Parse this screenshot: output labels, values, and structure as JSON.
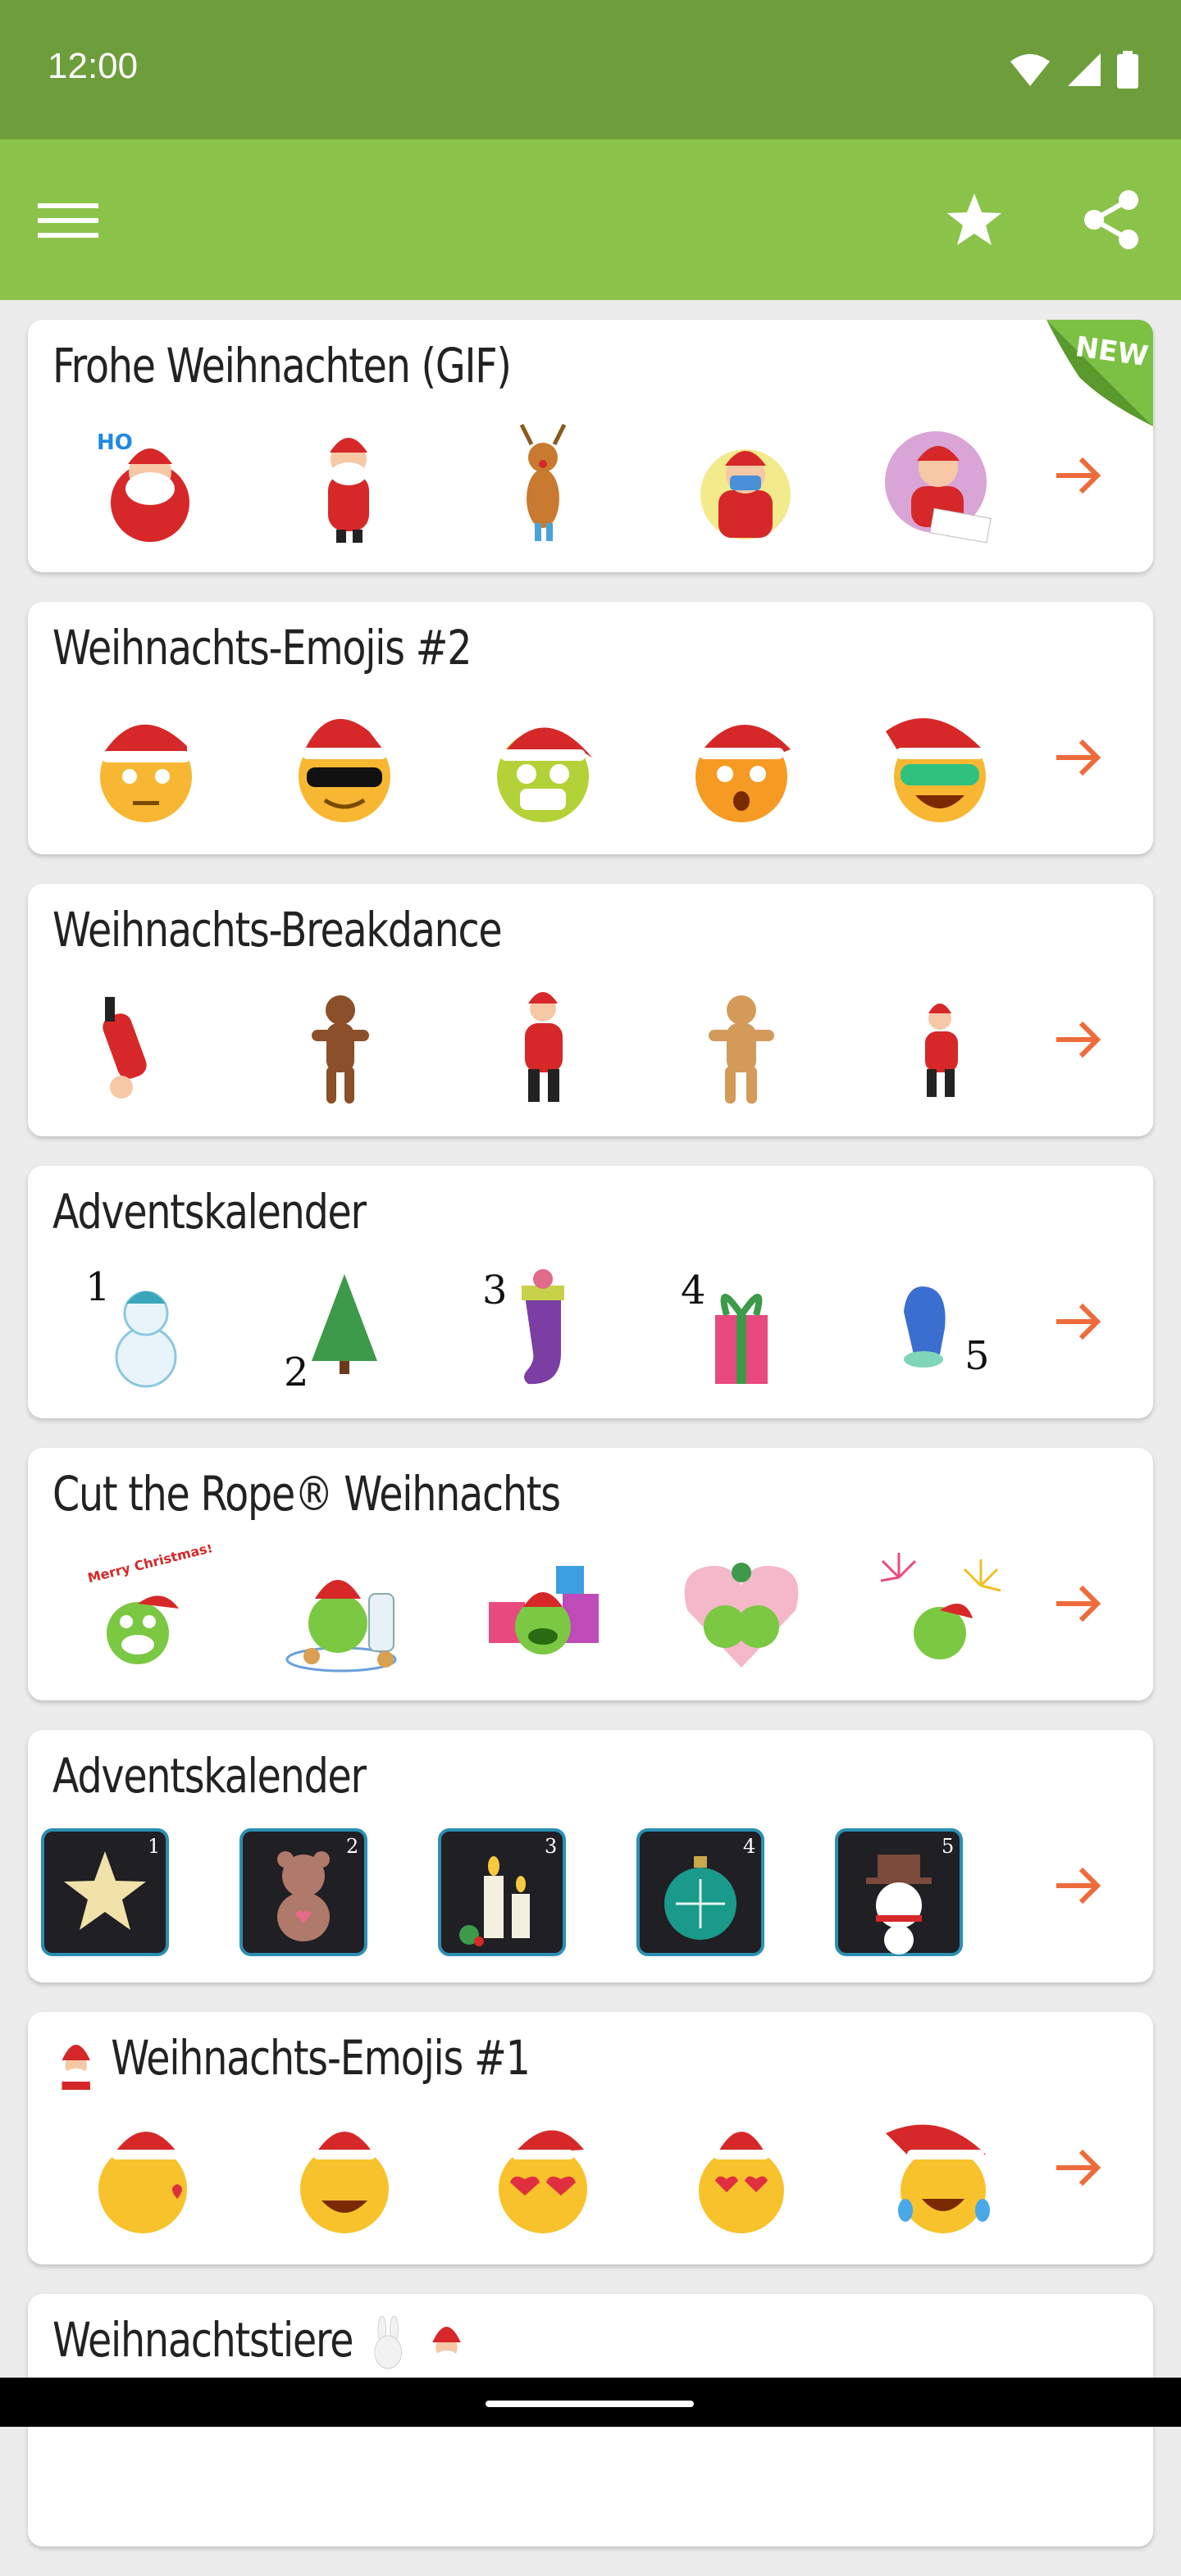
{
  "status_bar": {
    "time": "12:00"
  },
  "toolbar": {
    "menu_icon": "hamburger-menu-icon",
    "favorites_icon": "star-icon",
    "share_icon": "share-icon"
  },
  "colors": {
    "status_bar": "#6e9e3c",
    "app_bar": "#8bc34a",
    "arrow": "#ee6b3b",
    "new_badge": "#7cc144"
  },
  "cards": [
    {
      "title": "Frohe Weihnachten (GIF)",
      "badge": "NEW",
      "stickers": [
        "santa-ho-ho",
        "santa-phone",
        "reindeer",
        "santa-mask",
        "santa-writing-letter"
      ]
    },
    {
      "title": "Weihnachts-Emojis #2",
      "stickers": [
        "emoji-eyeroll-santa-hat",
        "emoji-sunglasses-santa-hat",
        "emoji-mask-santa-hat",
        "emoji-dizzy-santa-hat",
        "emoji-green-glasses-santa-hat"
      ]
    },
    {
      "title": "Weihnachts-Breakdance",
      "stickers": [
        "santa-breakdance",
        "gingerbread-man",
        "santa-dancing",
        "gingerbread-man-light",
        "santa-small-dancing"
      ]
    },
    {
      "title": "Adventskalender",
      "stickers": [
        "snowman-1",
        "tree-2",
        "stocking-3",
        "gift-4",
        "mitten-5"
      ],
      "numbers": [
        "1",
        "2",
        "3",
        "4",
        "5"
      ]
    },
    {
      "title": "Cut the Rope® Weihnachts",
      "stickers": [
        "om-nom-merry-christmas",
        "om-nom-cookies-milk",
        "om-nom-presents",
        "om-nom-heart",
        "om-nom-fireworks"
      ],
      "sticker_text": "Merry Christmas!"
    },
    {
      "title": "Adventskalender",
      "stickers": [
        "tile-star-1",
        "tile-teddy-2",
        "tile-candles-3",
        "tile-bauble-4",
        "tile-snowman-5"
      ],
      "numbers": [
        "1",
        "2",
        "3",
        "4",
        "5"
      ]
    },
    {
      "title": "Weihnachts-Emojis #1",
      "title_icon": "santa-emoji-icon",
      "stickers": [
        "emoji-kiss-santa-hat",
        "emoji-grin-santa-hat",
        "emoji-heart-sunglasses-santa-hat",
        "emoji-heart-eyes-santa-hat",
        "emoji-tears-of-joy-santa-hat"
      ]
    },
    {
      "title": "Weihnachtstiere",
      "title_icons": [
        "bunny-icon",
        "santa-icon"
      ]
    }
  ]
}
